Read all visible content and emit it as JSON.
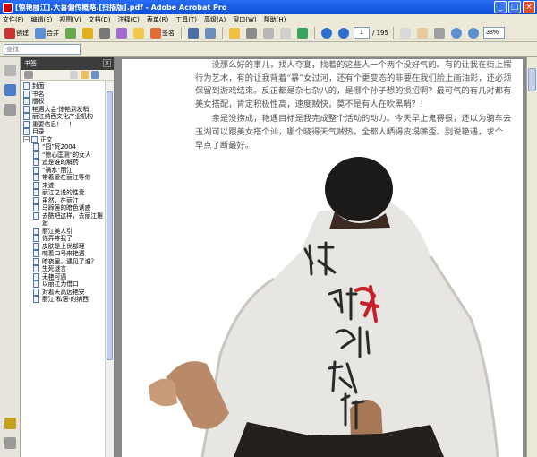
{
  "window": {
    "title": "[惊艳丽江].大喜偏传概略.[扫描版].pdf - Adobe Acrobat Pro"
  },
  "menu": [
    "文件(F)",
    "编辑(E)",
    "视图(V)",
    "文档(D)",
    "注释(C)",
    "表单(R)",
    "工具(T)",
    "高级(A)",
    "窗口(W)",
    "帮助(H)"
  ],
  "toolbar": {
    "create": "创建",
    "combine": "合并",
    "sign": "签名",
    "page_current": "1",
    "page_total": "/ 195",
    "zoom": "38%"
  },
  "find": {
    "placeholder": "查找"
  },
  "nav": {
    "title": "书签",
    "close": "×"
  },
  "bookmarks": [
    {
      "label": "封面",
      "indent": 0,
      "toggle": ""
    },
    {
      "label": "书名",
      "indent": 0,
      "toggle": ""
    },
    {
      "label": "版权",
      "indent": 0,
      "toggle": ""
    },
    {
      "label": "艳遇大会·惊艳到发梢",
      "indent": 0,
      "toggle": ""
    },
    {
      "label": "丽江纳西文化产业机构",
      "indent": 0,
      "toggle": ""
    },
    {
      "label": "重要信息！！！",
      "indent": 0,
      "toggle": ""
    },
    {
      "label": "目录",
      "indent": 0,
      "toggle": ""
    },
    {
      "label": "正文",
      "indent": 0,
      "toggle": "−"
    },
    {
      "label": "“囧”死2004",
      "indent": 1,
      "toggle": ""
    },
    {
      "label": "“惊心匡测”的女人",
      "indent": 1,
      "toggle": ""
    },
    {
      "label": "追是谁的解药",
      "indent": 1,
      "toggle": ""
    },
    {
      "label": "“祸水”丽江",
      "indent": 1,
      "toggle": ""
    },
    {
      "label": "带着爱在丽江等你",
      "indent": 1,
      "toggle": ""
    },
    {
      "label": "来迹",
      "indent": 1,
      "toggle": ""
    },
    {
      "label": "丽江之说的性爱",
      "indent": 1,
      "toggle": ""
    },
    {
      "label": "虽然，在丽江",
      "indent": 1,
      "toggle": ""
    },
    {
      "label": "马蹄莲的暗色诱惑",
      "indent": 1,
      "toggle": ""
    },
    {
      "label": "去酰吧这样，去丽江邂逅",
      "indent": 1,
      "toggle": ""
    },
    {
      "label": "丽江美人引",
      "indent": 1,
      "toggle": ""
    },
    {
      "label": "你弄疼我了",
      "indent": 1,
      "toggle": ""
    },
    {
      "label": "皮肤是上优部理",
      "indent": 1,
      "toggle": ""
    },
    {
      "label": "喊着口号来艳遇",
      "indent": 1,
      "toggle": ""
    },
    {
      "label": "暗夜里，遇见了谁？",
      "indent": 1,
      "toggle": ""
    },
    {
      "label": "生死谜言",
      "indent": 1,
      "toggle": ""
    },
    {
      "label": "无艳可遇",
      "indent": 1,
      "toggle": ""
    },
    {
      "label": "以丽江为借口",
      "indent": 1,
      "toggle": ""
    },
    {
      "label": "对着天高远艳安",
      "indent": 1,
      "toggle": ""
    },
    {
      "label": "丽江·私语·的纳西",
      "indent": 1,
      "toggle": ""
    }
  ],
  "page_text": [
    "没那么好的事儿，找人夺宴，找着的这些人一个两个没好气的。有的让我在街上摆行为艺术，有的让我背着“暴”女过河，还有个更变态的非要在我们脸上画油彩，还必须保留到游戏结束。反正都是杂七杂八的，是哪个孙子想的损招啊？最可气的有几对都有美女搭配，肯定积极性高，速度贼快，莫不是有人在吹黑哨？！",
    "亲是没捞成，艳遇目标是我完成整个活动的动力。今天早上鬼得很，还以为骑车去玉湖可以跟美女搭个讪，哪个晓得天气贼热，全都人晒得皮塌嘴歪。别说艳遇，求个　　　　　　　　早点了断最好。"
  ],
  "shirt_text": "惊艳到发梢"
}
